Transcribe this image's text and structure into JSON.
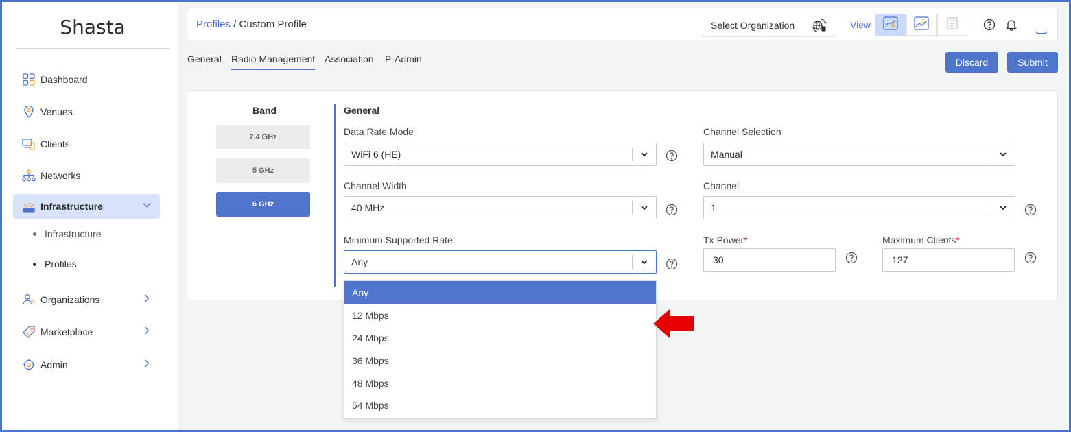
{
  "app": {
    "brand": "Shasta"
  },
  "sidebar": {
    "items": [
      {
        "label": "Dashboard",
        "icon": "dashboard-icon"
      },
      {
        "label": "Venues",
        "icon": "location-pin-icon"
      },
      {
        "label": "Clients",
        "icon": "clients-icon"
      },
      {
        "label": "Networks",
        "icon": "network-icon"
      },
      {
        "label": "Infrastructure",
        "icon": "infrastructure-icon",
        "expanded": true,
        "active": true
      },
      {
        "label": "Organizations",
        "icon": "organizations-icon"
      },
      {
        "label": "Marketplace",
        "icon": "marketplace-icon"
      },
      {
        "label": "Admin",
        "icon": "admin-gear-icon"
      }
    ],
    "subitems": [
      {
        "label": "Infrastructure"
      },
      {
        "label": "Profiles",
        "current": true
      }
    ]
  },
  "header": {
    "breadcrumb_link": "Profiles",
    "breadcrumb_sep": " / ",
    "breadcrumb_current": "Custom Profile",
    "select_org": "Select Organization",
    "view_label": "View"
  },
  "tabs": [
    {
      "label": "General"
    },
    {
      "label": "Radio Management",
      "active": true
    },
    {
      "label": "Association"
    },
    {
      "label": "P-Admin"
    }
  ],
  "actions": {
    "discard": "Discard",
    "submit": "Submit"
  },
  "band": {
    "title": "Band",
    "options": [
      "2.4 GHz",
      "5 GHz",
      "6 GHz"
    ],
    "selected": "6 GHz"
  },
  "general": {
    "title": "General",
    "data_rate_mode": {
      "label": "Data Rate Mode",
      "value": "WiFi 6 (HE)"
    },
    "channel_selection": {
      "label": "Channel Selection",
      "value": "Manual"
    },
    "channel_width": {
      "label": "Channel Width",
      "value": "40 MHz"
    },
    "channel": {
      "label": "Channel",
      "value": "1"
    },
    "min_supported_rate": {
      "label": "Minimum Supported Rate",
      "value": "Any"
    },
    "tx_power": {
      "label": "Tx Power",
      "required": "*",
      "value": "30"
    },
    "max_clients": {
      "label": "Maximum Clients",
      "required": "*",
      "value": "127"
    }
  },
  "dropdown": {
    "options": [
      "Any",
      "12 Mbps",
      "24 Mbps",
      "36 Mbps",
      "48 Mbps",
      "54 Mbps"
    ],
    "selected": "Any"
  },
  "colors": {
    "accent": "#4f74cc",
    "active_bg": "#d8e3fb",
    "required": "#d9382e",
    "annotation_arrow": "#e60000"
  }
}
